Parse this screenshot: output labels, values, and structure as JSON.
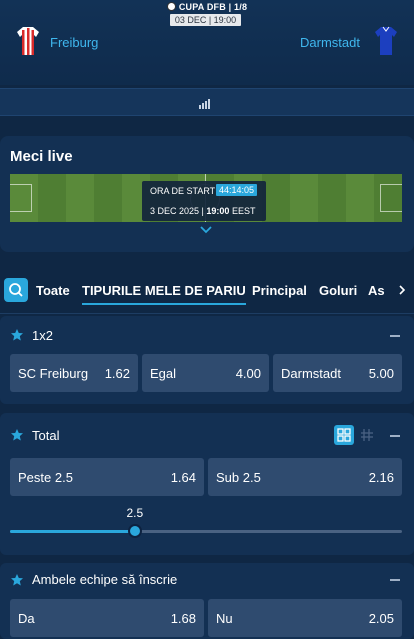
{
  "header": {
    "competition": "CUPA DFB | 1/8",
    "date": "03 DEC | 19:00",
    "home_team": "Freiburg",
    "away_team": "Darmstadt",
    "home_jersey_colors": [
      "#d92b2b",
      "#ffffff"
    ],
    "away_jersey_color": "#1c3fbf"
  },
  "stats_bar": {
    "icon": "stats-bars-icon"
  },
  "live": {
    "title": "Meci live",
    "kickoff_label": "ORA DE START",
    "countdown": "44:14:05",
    "date": "3 DEC 2025 |",
    "time": "19:00",
    "timezone": "EEST"
  },
  "tabs": {
    "items": [
      {
        "label": "Toate",
        "active": false
      },
      {
        "label": "TIPURILE MELE DE PARIU",
        "active": true
      },
      {
        "label": "Principal",
        "active": false
      },
      {
        "label": "Goluri",
        "active": false
      },
      {
        "label": "As",
        "active": false
      }
    ]
  },
  "markets": {
    "m1x2": {
      "title": "1x2",
      "odds": [
        {
          "label": "SC Freiburg",
          "value": "1.62"
        },
        {
          "label": "Egal",
          "value": "4.00"
        },
        {
          "label": "Darmstadt",
          "value": "5.00"
        }
      ]
    },
    "total": {
      "title": "Total",
      "odds": [
        {
          "label": "Peste 2.5",
          "value": "1.64"
        },
        {
          "label": "Sub 2.5",
          "value": "2.16"
        }
      ],
      "slider_value": "2.5",
      "slider_fraction": 0.32
    },
    "btts": {
      "title": "Ambele echipe să înscrie",
      "odds": [
        {
          "label": "Da",
          "value": "1.68"
        },
        {
          "label": "Nu",
          "value": "2.05"
        }
      ]
    }
  },
  "colors": {
    "accent": "#2aa7dc",
    "background": "#0f2744",
    "card": "#133053",
    "odd_button": "#2f4b6f",
    "team_text": "#3fb7ee"
  }
}
